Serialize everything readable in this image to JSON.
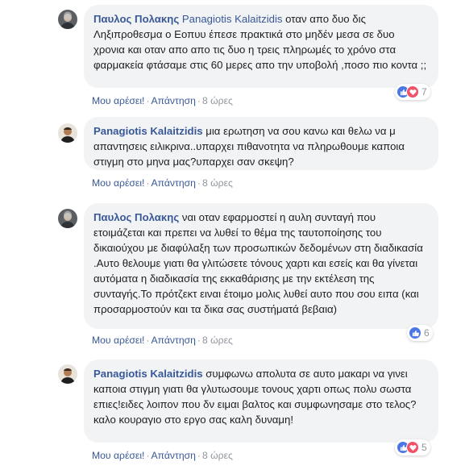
{
  "comments": [
    {
      "author": "Παυλος Πολακης",
      "mention": "Panagiotis Kalaitzidis",
      "text": "οταν απο δυο δις Ληξιπροθεσμα ο Εοπυυ έπεσε πρακτικά στο μηδέν μεσα σε δυο χρονια και οταν απο απο τις δυο η τρεις πληρωμές το χρόνο στα φαρμακεία φτάσαμε στις 60 μερες απο την υποβολή ,ποσο πιο κοντα ;;",
      "actions": {
        "like": "Μου αρέσει!",
        "reply": "Απάντηση",
        "time": "8 ώρες"
      },
      "reactions": {
        "count": "7",
        "types": [
          "like",
          "love"
        ]
      }
    },
    {
      "author": "Panagiotis Kalaitzidis",
      "mention": "",
      "text": "μια ερωτηση να σου κανω και θελω να μ απαντησεις ειλικρινα..υπαρχει πιθανοτητα να πληρωθουμε καποια στιγμη στο μηνα μας?υπαρχει σαν σκεψη?",
      "actions": {
        "like": "Μου αρέσει!",
        "reply": "Απάντηση",
        "time": "8 ώρες"
      },
      "reactions": null
    },
    {
      "author": "Παυλος Πολακης",
      "mention": "",
      "text": "ναι οταν εφαρμοστεί η αυλη συνταγή που ετοιμάζεται και πρεπει να λυθεί το θέμα της ταυτοποίησης του δικαιούχου με διαφύλαξη των προσωπικών δεδομένων στη διαδικασία .Αυτο θελουμε γιατι θα γλιτώσετε τόνους χαρτι και εσείς και θα γίνεται αυτόματα η διαδικασία της εκκαθάρισης με την εκτέλεση της συνταγής.Το πρότζεκτ ειναι έτοιμο μολις λυθεί αυτο που σου ειπα (και προσαρμοστούν και τα δικα σας συστήματά βεβαια)",
      "actions": {
        "like": "Μου αρέσει!",
        "reply": "Απάντηση",
        "time": "8 ώρες"
      },
      "reactions": {
        "count": "6",
        "types": [
          "like"
        ]
      }
    },
    {
      "author": "Panagiotis Kalaitzidis",
      "mention": "",
      "text": "συμφωνω απολυτα σε αυτο μακαρι να γινει καποια στιγμη γιατι θα γλυτωσουμε τονους χαρτι οπως πολυ σωστα επιες!ειδες λοιπον που δν ειμαι βαλτος και συμφωνησαμε στο τελος? καλο κουραγιο στο εργο σας καλη δυναμη!",
      "actions": {
        "like": "Μου αρέσει!",
        "reply": "Απάντηση",
        "time": "8 ώρες"
      },
      "reactions": {
        "count": "5",
        "types": [
          "like",
          "love"
        ]
      }
    }
  ],
  "colors": {
    "link": "#385898",
    "bubble": "#f2f3f5",
    "meta": "#90949c",
    "like": "#4a76e6",
    "love": "#f25268"
  }
}
